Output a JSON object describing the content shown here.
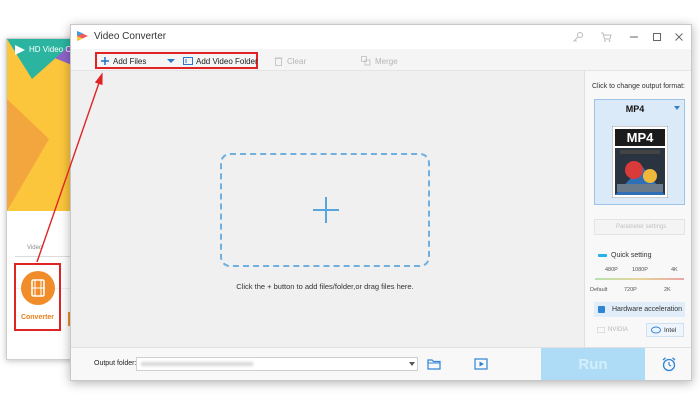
{
  "background_app": {
    "title": "HD Video Conv",
    "video_label": "Video",
    "converter_label": "Converter"
  },
  "window": {
    "title": "Video Converter"
  },
  "toolbar": {
    "add_files": "Add Files",
    "add_video_folder": "Add Video Folder",
    "clear": "Clear",
    "merge": "Merge"
  },
  "main": {
    "drop_hint": "Click the + button to add files/folder,or drag files here."
  },
  "right_panel": {
    "change_format_hint": "Click to change output format:",
    "format_name": "MP4",
    "format_icon_text": "MP4",
    "param_settings": "Parameter settings",
    "quick_setting": "Quick setting",
    "quality_top": [
      "480P",
      "1080P",
      "4K"
    ],
    "quality_bottom": [
      "Default",
      "720P",
      "2K"
    ],
    "hardware_acceleration": "Hardware acceleration",
    "nvidia": "NVIDIA",
    "intel": "Intel"
  },
  "bottom": {
    "output_folder_label": "Output folder:",
    "run": "Run"
  },
  "colors": {
    "accent_blue": "#3a7fc4",
    "highlight_red": "#e02424",
    "converter_orange": "#f08c2a",
    "run_button": "#aedcf6"
  }
}
